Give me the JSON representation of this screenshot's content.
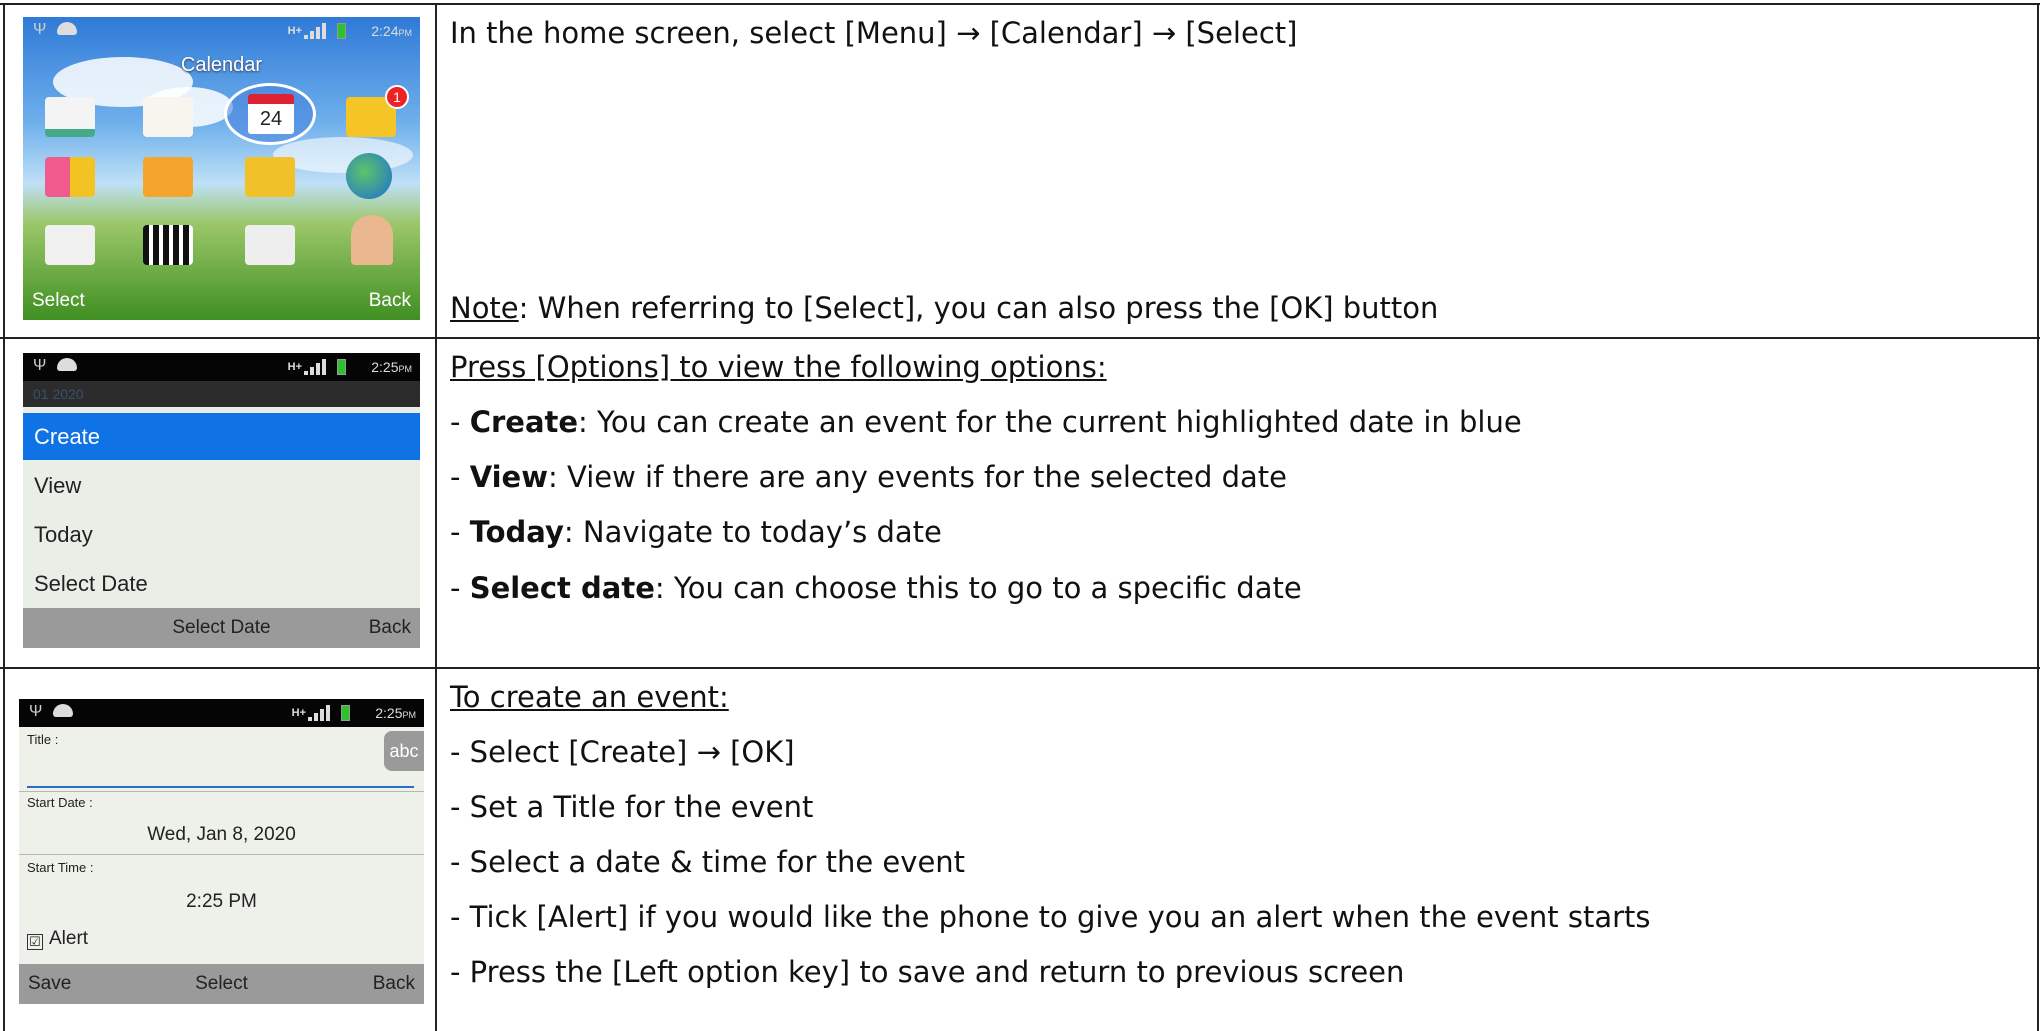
{
  "rows": [
    {
      "phone": {
        "status_time": "2:24",
        "status_time_suffix": "PM",
        "network": "H+",
        "app_title": "Calendar",
        "calendar_day": "24",
        "mail_badge": "1",
        "softkey_left": "Select",
        "softkey_right": "Back"
      },
      "lines": [
        "In the home screen, select [Menu] → [Calendar] → [Select]"
      ],
      "note_label": "Note",
      "note_text": ": When referring to [Select], you can also press the [OK] button"
    },
    {
      "phone": {
        "status_time": "2:25",
        "status_time_suffix": "PM",
        "network": "H+",
        "date_header": "01 2020",
        "menu": [
          "Create",
          "View",
          "Today",
          "Select Date"
        ],
        "softkey_center": "Select Date",
        "softkey_right": "Back"
      },
      "heading": "Press [Options] to view the following options:",
      "items": [
        {
          "dash": "- ",
          "term": "Create",
          "desc": ": You can create an event for the current highlighted date in blue"
        },
        {
          "dash": "- ",
          "term": "View",
          "desc": ": View if there are any events for the selected date"
        },
        {
          "dash": "- ",
          "term": "Today",
          "desc": ": Navigate to today’s date"
        },
        {
          "dash": "- ",
          "term": "Select date",
          "desc": ": You can choose this to go to a specific date"
        }
      ]
    },
    {
      "phone": {
        "status_time": "2:25",
        "status_time_suffix": "PM",
        "network": "H+",
        "title_label": "Title :",
        "abc": "abc",
        "start_date_label": "Start Date :",
        "start_date_value": "Wed, Jan 8, 2020",
        "start_time_label": "Start Time :",
        "start_time_value": "2:25 PM",
        "alert_label": "Alert",
        "check_mark": "☑",
        "softkey_left": "Save",
        "softkey_center": "Select",
        "softkey_right": "Back"
      },
      "heading": "To create an event:",
      "lines": [
        "- Select [Create] → [OK]",
        "- Set a Title for the event",
        "- Select a date & time for the event",
        "- Tick [Alert] if you would like the phone to give you an alert when the event starts",
        "- Press the [Left option key] to save and return to previous screen"
      ]
    }
  ]
}
